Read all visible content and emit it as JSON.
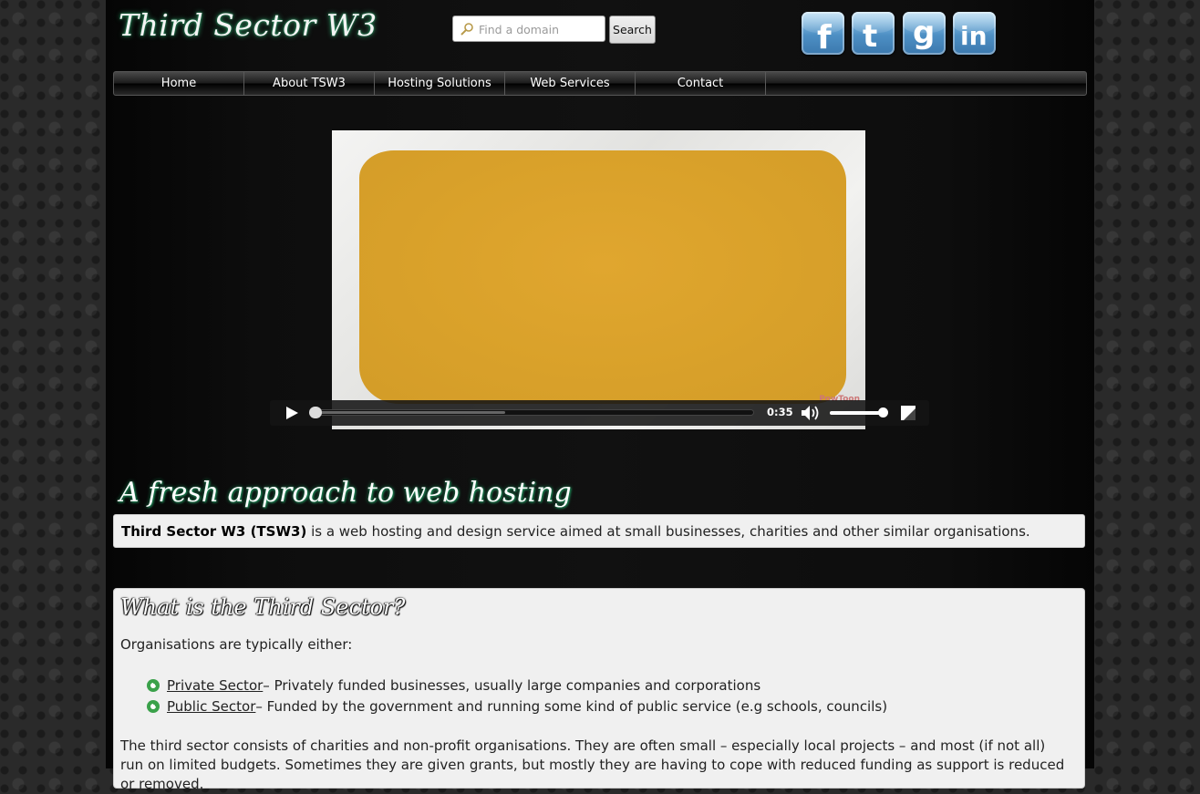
{
  "site": {
    "logo_text": "Third Sector W3"
  },
  "search": {
    "placeholder": "Find a domain",
    "value": "",
    "button_label": "Search"
  },
  "social": [
    "facebook-icon",
    "twitter-icon",
    "google-icon",
    "linkedin-icon"
  ],
  "nav": {
    "items": [
      "Home",
      "About TSW3",
      "Hosting Solutions",
      "Web Services",
      "Contact"
    ]
  },
  "video": {
    "time": "0:35",
    "watermark": "PowToon",
    "progress": 0.0,
    "buffered": 0.44,
    "volume": 0.9
  },
  "tagline": "A fresh approach to web hosting",
  "intro": {
    "bold": "Third Sector W3 (TSW3)",
    "text": " is a web hosting and design service aimed at small businesses, charities and other similar organisations."
  },
  "third_sector": {
    "title": "What is the Third Sector?",
    "lead": "Organisations are typically either:",
    "items": [
      {
        "link": "Private Sector",
        "text": " – Privately funded businesses, usually large companies and corporations"
      },
      {
        "link": "Public Sector",
        "text": " – Funded by the government and running some kind of public service (e.g schools, councils)"
      }
    ],
    "body": "The third sector consists of charities and non-profit organisations. They are often small – especially local projects – and most (if not all) run on limited budgets. Sometimes they are given grants, but mostly they are having to cope with reduced funding as support is reduced or removed."
  }
}
